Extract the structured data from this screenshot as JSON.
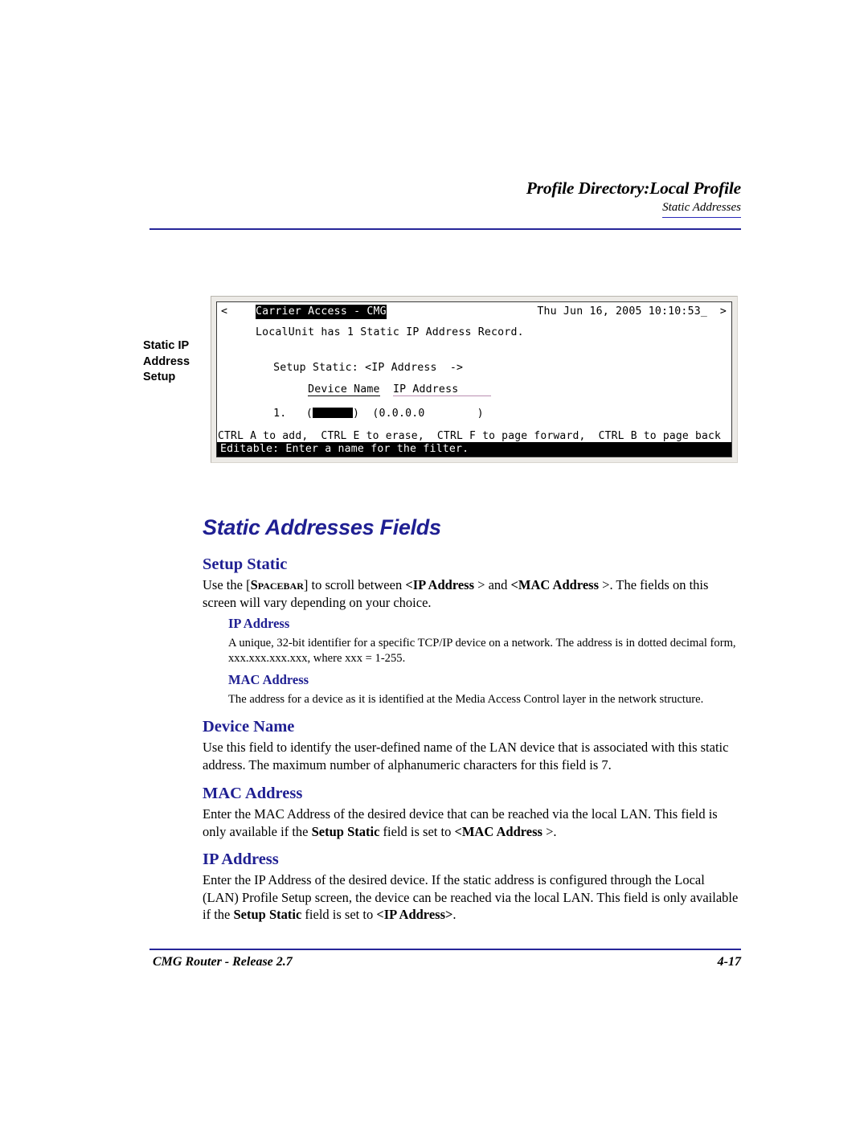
{
  "header": {
    "title": "Profile Directory:Local Profile",
    "subtitle": "Static Addresses"
  },
  "figure": {
    "caption_line1": "Static IP",
    "caption_line2": "Address",
    "caption_line3": "Setup",
    "terminal": {
      "left_arrow": "<",
      "right_arrow": ">",
      "title": "Carrier Access - CMG",
      "datetime": "Thu Jun 16, 2005 10:10:53_",
      "record_line": "LocalUnit has 1 Static IP Address Record.",
      "setup_static_label": "Setup Static:",
      "setup_static_value": "<IP Address  ->",
      "col_device_name": "Device Name",
      "col_ip_address": "IP Address",
      "row_index": "1.",
      "row_device_name": "",
      "row_ip_address": "0.0.0.0",
      "help_line": "CTRL A to add,  CTRL E to erase,  CTRL F to page forward,  CTRL B to page back",
      "status_line": "Editable: Enter a name for the filter."
    }
  },
  "content": {
    "section_title": "Static Addresses Fields",
    "setup_static": {
      "heading": "Setup Static",
      "body_pre": "Use the [",
      "body_spacebar": "Spacebar",
      "body_mid1": "] to scroll between ",
      "body_b1": "<IP Address",
      "body_mid2": " > and ",
      "body_b2": "<MAC Address",
      "body_post": " >. The fields on this screen will vary depending on your choice."
    },
    "sub_ip_address": {
      "heading": "IP Address",
      "body": "A unique, 32-bit identifier for a specific TCP/IP device on a network. The address is in dotted decimal form, xxx.xxx.xxx.xxx, where xxx = 1-255."
    },
    "sub_mac_address": {
      "heading": "MAC Address",
      "body": "The address for a device as it is identified at the Media Access Control layer in the network structure."
    },
    "device_name": {
      "heading": "Device Name",
      "body": "Use this field to identify the user-defined name of the LAN device that is associated with this static address. The maximum number of alphanumeric characters for this field is 7."
    },
    "mac_address": {
      "heading": "MAC Address",
      "body_pre": "Enter the MAC Address of the desired device that can be reached via the local LAN. This field is only available if the ",
      "body_b1": "Setup Static",
      "body_mid": " field is set to ",
      "body_b2": "<MAC Address",
      "body_post": " >."
    },
    "ip_address": {
      "heading": "IP Address",
      "body_pre": "Enter the IP Address of the desired device. If the static address is configured through the Local (LAN) Profile Setup screen, the device can be reached via the local LAN. This field is only available if the ",
      "body_b1": "Setup Static",
      "body_mid": " field is set to ",
      "body_b2": "<IP Address>",
      "body_post": "."
    }
  },
  "footer": {
    "left": "CMG Router - Release 2.7",
    "right": "4-17"
  },
  "colors": {
    "heading_blue": "#1f1f92",
    "rule_blue": "#262699",
    "terminal_bg": "#ffffff",
    "terminal_frame": "#eceae6",
    "underline_pink": "#b98fb1"
  }
}
